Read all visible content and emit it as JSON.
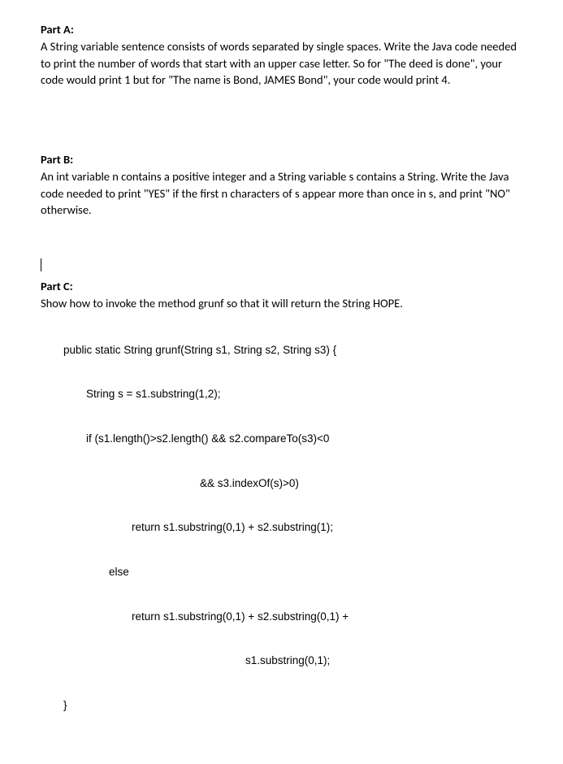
{
  "partA": {
    "heading": "Part A:",
    "text": "A String variable sentence consists of words separated by single spaces.\nWrite the Java code needed to print the number of words that start with an upper case letter. So for \"The deed is done\", your code would print 1 but for \"The name is Bond, JAMES Bond\", your code would print 4."
  },
  "partB": {
    "heading": "Part B:",
    "text": "An int variable n contains a positive integer and a String variable s contains a String. Write the Java code needed to print \"YES\" if the first n characters of s appear more than once in s, and print \"NO\" otherwise."
  },
  "partC": {
    "heading": "Part C:",
    "intro": "Show how to invoke the method grunf so that it will return the String HOPE.",
    "code": {
      "l1": "public static String grunf(String s1, String s2, String s3) {",
      "l2": "String s = s1.substring(1,2);",
      "l3": "if (s1.length()>s2.length() && s2.compareTo(s3)<0",
      "l4": "&& s3.indexOf(s)>0)",
      "l5": "return s1.substring(0,1) + s2.substring(1);",
      "l6": "else",
      "l7": "return s1.substring(0,1) + s2.substring(0,1) +",
      "l8": "s1.substring(0,1);",
      "l9": "}"
    }
  }
}
